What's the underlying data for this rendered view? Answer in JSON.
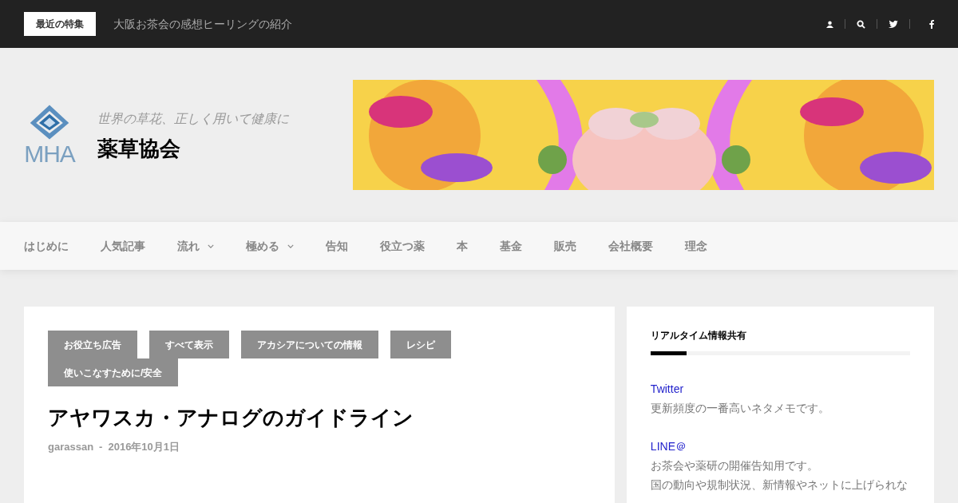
{
  "top_bar": {
    "label": "最近の特集",
    "ticker": "大阪お茶会の感想ヒーリングの紹介"
  },
  "header": {
    "logo_text": "MHA",
    "tagline": "世界の草花、正しく用いて健康に",
    "site_title": "薬草協会"
  },
  "nav": {
    "items": [
      {
        "label": "はじめに",
        "dropdown": false
      },
      {
        "label": "人気記事",
        "dropdown": false
      },
      {
        "label": "流れ",
        "dropdown": true
      },
      {
        "label": "極める",
        "dropdown": true
      },
      {
        "label": "告知",
        "dropdown": false
      },
      {
        "label": "役立つ薬",
        "dropdown": false
      },
      {
        "label": "本",
        "dropdown": false
      },
      {
        "label": "基金",
        "dropdown": false
      },
      {
        "label": "販売",
        "dropdown": false
      },
      {
        "label": "会社概要",
        "dropdown": false
      },
      {
        "label": "理念",
        "dropdown": false
      }
    ]
  },
  "article": {
    "categories": [
      "お役立ち広告",
      "すべて表示",
      "アカシアについての情報",
      "レシピ",
      "使いこなすために/安全"
    ],
    "title": "アヤワスカ・アナログのガイドライン",
    "author": "garassan",
    "separator": "-",
    "date": "2016年10月1日"
  },
  "sidebar": {
    "title": "リアルタイム情報共有",
    "entries": [
      {
        "link": "Twitter",
        "lines": [
          "更新頻度の一番高いネタメモです。"
        ]
      },
      {
        "link": "LINE＠",
        "lines": [
          "お茶会や薬研の開催告知用です。",
          "国の動向や規制状況、新情報やネットに上げられな"
        ]
      }
    ]
  }
}
